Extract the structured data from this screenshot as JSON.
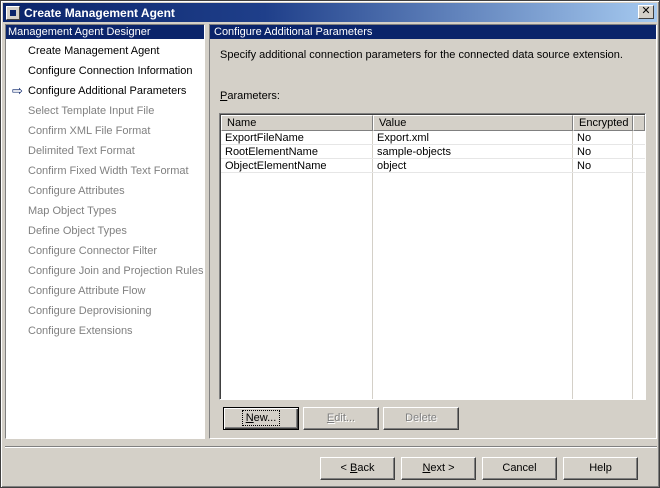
{
  "window": {
    "title": "Create Management Agent",
    "close_glyph": "✕"
  },
  "left_pane": {
    "header": "Management Agent Designer",
    "current_arrow": "⇨",
    "steps": [
      {
        "label": "Create Management Agent",
        "state": "done"
      },
      {
        "label": "Configure Connection Information",
        "state": "done"
      },
      {
        "label": "Configure Additional Parameters",
        "state": "current"
      },
      {
        "label": "Select Template Input File",
        "state": "pending"
      },
      {
        "label": "Confirm XML File Format",
        "state": "pending"
      },
      {
        "label": "Delimited Text Format",
        "state": "pending"
      },
      {
        "label": "Confirm Fixed Width Text Format",
        "state": "pending"
      },
      {
        "label": "Configure Attributes",
        "state": "pending"
      },
      {
        "label": "Map Object Types",
        "state": "pending"
      },
      {
        "label": "Define Object Types",
        "state": "pending"
      },
      {
        "label": "Configure Connector Filter",
        "state": "pending"
      },
      {
        "label": "Configure Join and Projection Rules",
        "state": "pending"
      },
      {
        "label": "Configure Attribute Flow",
        "state": "pending"
      },
      {
        "label": "Configure Deprovisioning",
        "state": "pending"
      },
      {
        "label": "Configure Extensions",
        "state": "pending"
      }
    ]
  },
  "main": {
    "header": "Configure Additional Parameters",
    "description": "Specify additional connection parameters for the connected data source extension.",
    "params_label_accel": "P",
    "params_label_rest": "arameters:",
    "table": {
      "columns": [
        "Name",
        "Value",
        "Encrypted"
      ],
      "rows": [
        [
          "ExportFileName",
          "Export.xml",
          "No"
        ],
        [
          "RootElementName",
          "sample-objects",
          "No"
        ],
        [
          "ObjectElementName",
          "object",
          "No"
        ]
      ]
    },
    "buttons": {
      "new_accel": "N",
      "new_rest": "ew...",
      "edit_accel": "E",
      "edit_rest": "dit...",
      "delete": "Delete"
    }
  },
  "footer": {
    "back_prefix": "< ",
    "back_accel": "B",
    "back_rest": "ack",
    "next_accel": "N",
    "next_rest": "ext >",
    "cancel": "Cancel",
    "help": "Help"
  }
}
